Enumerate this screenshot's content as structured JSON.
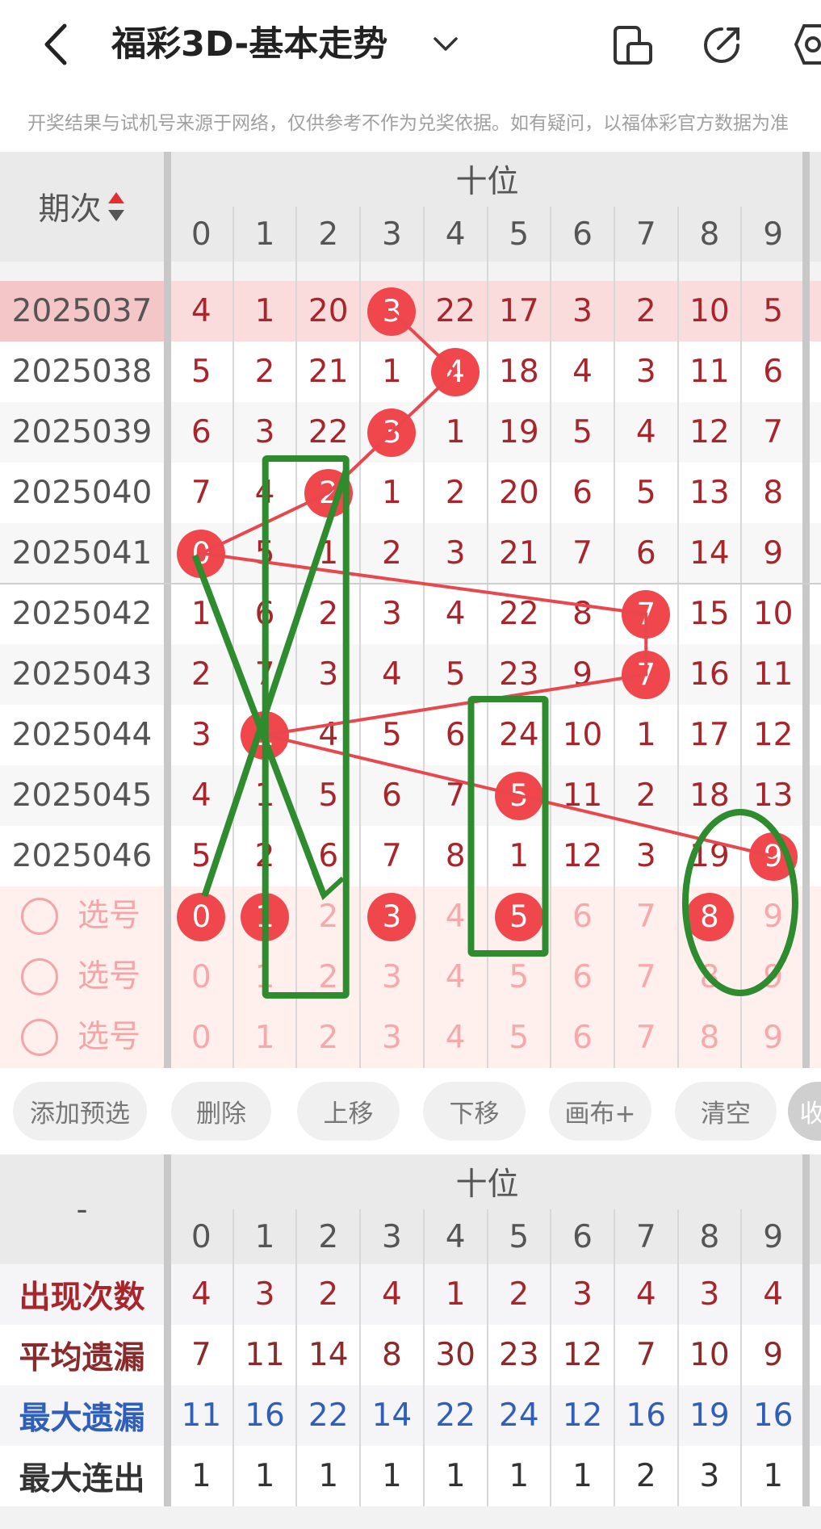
{
  "header": {
    "title": "福彩3D-基本走势",
    "back_icon": "chevron-left-icon",
    "dropdown_icon": "chevron-down-icon",
    "icons": [
      "device-icon",
      "share-icon",
      "settings-icon"
    ]
  },
  "notice": "开奖结果与试机号来源于网络，仅供参考不作为兑奖依据。如有疑问，以福体彩官方数据为准",
  "grid": {
    "period_header": "期次",
    "section_header": "十位",
    "digits": [
      "0",
      "1",
      "2",
      "3",
      "4",
      "5",
      "6",
      "7",
      "8",
      "9"
    ],
    "rows": [
      {
        "period": "2025037",
        "cells": [
          "4",
          "1",
          "20",
          "3",
          "22",
          "17",
          "3",
          "2",
          "10",
          "5"
        ],
        "hit": 3,
        "highlight": true
      },
      {
        "period": "2025038",
        "cells": [
          "5",
          "2",
          "21",
          "1",
          "4",
          "18",
          "4",
          "3",
          "11",
          "6"
        ],
        "hit": 4
      },
      {
        "period": "2025039",
        "cells": [
          "6",
          "3",
          "22",
          "3",
          "1",
          "19",
          "5",
          "4",
          "12",
          "7"
        ],
        "hit": 3
      },
      {
        "period": "2025040",
        "cells": [
          "7",
          "4",
          "2",
          "1",
          "2",
          "20",
          "6",
          "5",
          "13",
          "8"
        ],
        "hit": 2
      },
      {
        "period": "2025041",
        "cells": [
          "0",
          "5",
          "1",
          "2",
          "3",
          "21",
          "7",
          "6",
          "14",
          "9"
        ],
        "hit": 0
      },
      {
        "period": "2025042",
        "cells": [
          "1",
          "6",
          "2",
          "3",
          "4",
          "22",
          "8",
          "7",
          "15",
          "10"
        ],
        "hit": 7
      },
      {
        "period": "2025043",
        "cells": [
          "2",
          "7",
          "3",
          "4",
          "5",
          "23",
          "9",
          "7",
          "16",
          "11"
        ],
        "hit": 7
      },
      {
        "period": "2025044",
        "cells": [
          "3",
          "1",
          "4",
          "5",
          "6",
          "24",
          "10",
          "1",
          "17",
          "12"
        ],
        "hit": 1
      },
      {
        "period": "2025045",
        "cells": [
          "4",
          "1",
          "5",
          "6",
          "7",
          "5",
          "11",
          "2",
          "18",
          "13"
        ],
        "hit": 5
      },
      {
        "period": "2025046",
        "cells": [
          "5",
          "2",
          "6",
          "7",
          "8",
          "1",
          "12",
          "3",
          "19",
          "9"
        ],
        "hit": 9
      }
    ],
    "pick_label": "选号",
    "pick_rows": [
      {
        "selected": [
          0,
          1,
          3,
          5,
          8
        ]
      },
      {
        "selected": []
      },
      {
        "selected": []
      }
    ]
  },
  "toolbar": {
    "buttons": [
      "添加预选",
      "删除",
      "上移",
      "下移",
      "画布+",
      "清空",
      "收"
    ]
  },
  "stats": {
    "corner": "-",
    "section_header": "十位",
    "rows": [
      {
        "label": "出现次数",
        "values": [
          "4",
          "3",
          "2",
          "4",
          "1",
          "2",
          "3",
          "4",
          "3",
          "4"
        ],
        "color": "#a8262b"
      },
      {
        "label": "平均遗漏",
        "values": [
          "7",
          "11",
          "14",
          "8",
          "30",
          "23",
          "12",
          "7",
          "10",
          "9"
        ],
        "color": "#8a2a2a"
      },
      {
        "label": "最大遗漏",
        "values": [
          "11",
          "16",
          "22",
          "14",
          "22",
          "24",
          "12",
          "16",
          "19",
          "16"
        ],
        "color": "#2f5fb8"
      },
      {
        "label": "最大连出",
        "values": [
          "1",
          "1",
          "1",
          "1",
          "1",
          "1",
          "1",
          "2",
          "3",
          "1"
        ],
        "color": "#333333"
      }
    ]
  },
  "colors": {
    "ball": "#f0474d",
    "line": "#e8474d",
    "annotation": "#2e8b2e"
  }
}
